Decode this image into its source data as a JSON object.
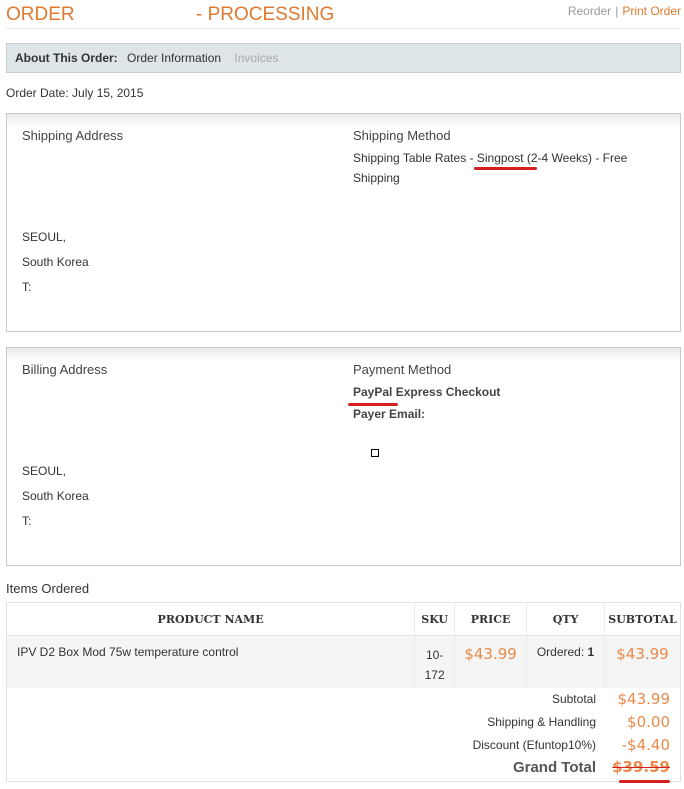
{
  "header": {
    "order_label": "ORDER",
    "status": "- PROCESSING",
    "reorder": "Reorder",
    "separator": "|",
    "print_order": "Print Order"
  },
  "about": {
    "label": "About This Order:",
    "tab_active": "Order Information",
    "tab_invoices": "Invoices"
  },
  "order_date": "Order Date: July 15, 2015",
  "shipping": {
    "address_heading": "Shipping Address",
    "address_lines": [
      "SEOUL,",
      "South Korea",
      "T:"
    ],
    "method_heading": "Shipping Method",
    "method_line1": "Shipping Table Rates - Singpost (2-4 Weeks) - Free",
    "method_line2": "Shipping"
  },
  "billing": {
    "address_heading": "Billing Address",
    "address_lines": [
      "SEOUL,",
      "South Korea",
      "T:"
    ],
    "method_heading": "Payment Method",
    "payment_method": "PayPal Express Checkout",
    "payer_email": "Payer Email:"
  },
  "items": {
    "heading": "Items Ordered",
    "columns": [
      "PRODUCT NAME",
      "SKU",
      "PRICE",
      "QTY",
      "SUBTOTAL"
    ],
    "rows": [
      {
        "name": "IPV D2 Box Mod 75w temperature control",
        "sku_line1": "10-",
        "sku_line2": "172",
        "price": "$43.99",
        "qty_label": "Ordered:",
        "qty": "1",
        "subtotal": "$43.99"
      }
    ]
  },
  "totals": {
    "subtotal_label": "Subtotal",
    "subtotal": "$43.99",
    "shipping_label": "Shipping & Handling",
    "shipping": "$0.00",
    "discount_label": "Discount (Efuntop10%)",
    "discount": "-$4.40",
    "grand_label": "Grand Total",
    "grand": "$39.59"
  },
  "colors": {
    "accent": "#e07a2f",
    "money": "#e98a4b",
    "annotation": "#d42020"
  }
}
